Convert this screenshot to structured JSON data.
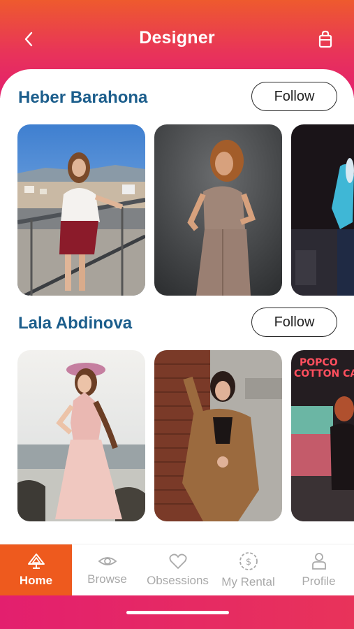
{
  "header": {
    "title": "Designer",
    "back_icon": "chevron-left-icon",
    "bag_icon": "shopping-bag-icon"
  },
  "designers": [
    {
      "name": "Heber Barahona",
      "follow_label": "Follow",
      "photos": [
        "woman-white-shirt-balcony-city",
        "woman-curly-hair-knit-jumpsuit",
        "model-neon-night"
      ]
    },
    {
      "name": "Lala Abdinova",
      "follow_label": "Follow",
      "photos": [
        "woman-flower-crown-pink-dress-beach",
        "woman-brown-blazer-brick-wall",
        "woman-popcorn-neon-sign"
      ]
    }
  ],
  "tabbar": {
    "items": [
      {
        "label": "Home",
        "icon": "home-icon",
        "active": true
      },
      {
        "label": "Browse",
        "icon": "eye-icon",
        "active": false
      },
      {
        "label": "Obsessions",
        "icon": "heart-icon",
        "active": false
      },
      {
        "label": "My Rental",
        "icon": "dollar-circle-icon",
        "active": false
      },
      {
        "label": "Profile",
        "icon": "user-icon",
        "active": false
      }
    ]
  },
  "colors": {
    "accent": "#ee5a1e",
    "brand_pink": "#e31f6e",
    "name_blue": "#1c5e8c",
    "tab_inactive": "#a9a9a9"
  }
}
